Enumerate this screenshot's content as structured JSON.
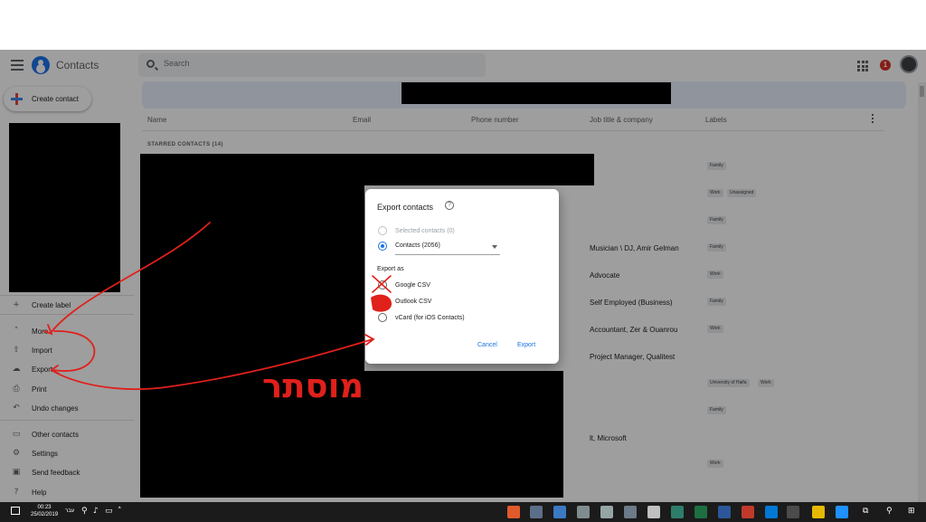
{
  "app": {
    "title": "Contacts",
    "search_placeholder": "Search",
    "notification_count": "1",
    "brand_color": "#1a73e8"
  },
  "sidebar": {
    "create_label": "Create contact",
    "items": [
      {
        "label": "Create label",
        "icon": "plus-icon"
      },
      {
        "label": "More",
        "icon": "chevron-up-icon"
      },
      {
        "label": "Import",
        "icon": "upload-icon"
      },
      {
        "label": "Export",
        "icon": "cloud-download-icon"
      },
      {
        "label": "Print",
        "icon": "print-icon"
      },
      {
        "label": "Undo changes",
        "icon": "undo-icon"
      },
      {
        "label": "Other contacts",
        "icon": "inbox-icon"
      },
      {
        "label": "Settings",
        "icon": "gear-icon"
      },
      {
        "label": "Send feedback",
        "icon": "feedback-icon"
      },
      {
        "label": "Help",
        "icon": "help-icon"
      }
    ]
  },
  "table": {
    "columns": [
      "Name",
      "Email",
      "Phone number",
      "Job title & company",
      "Labels"
    ],
    "section": "STARRED CONTACTS (14)",
    "jobs": [
      "Musician \\ DJ, Amir Gelman",
      "Advocate",
      "Self Employed (Business)",
      "Accountant, Zer & Ouanrou",
      "Project Manager, Qualitest",
      "lt, Microsoft"
    ],
    "chips": [
      "Family",
      "Work",
      "Unassigned",
      "Family",
      "Family",
      "Work",
      "Family",
      "Work",
      "University of Haifa",
      "Work",
      "Family",
      "Work"
    ]
  },
  "dialog": {
    "title": "Export contacts",
    "option_selected": "Selected contacts (0)",
    "option_contacts": "Contacts (2056)",
    "export_as": "Export as",
    "format_google": "Google CSV",
    "format_outlook": "Outlook CSV",
    "format_vcard": "vCard (for iOS Contacts)",
    "cancel": "Cancel",
    "export": "Export"
  },
  "annotation": {
    "text": "מוסתר",
    "color": "#e0201b"
  },
  "taskbar": {
    "time": "00:23",
    "date": "25/02/2019",
    "language": "עבר"
  }
}
